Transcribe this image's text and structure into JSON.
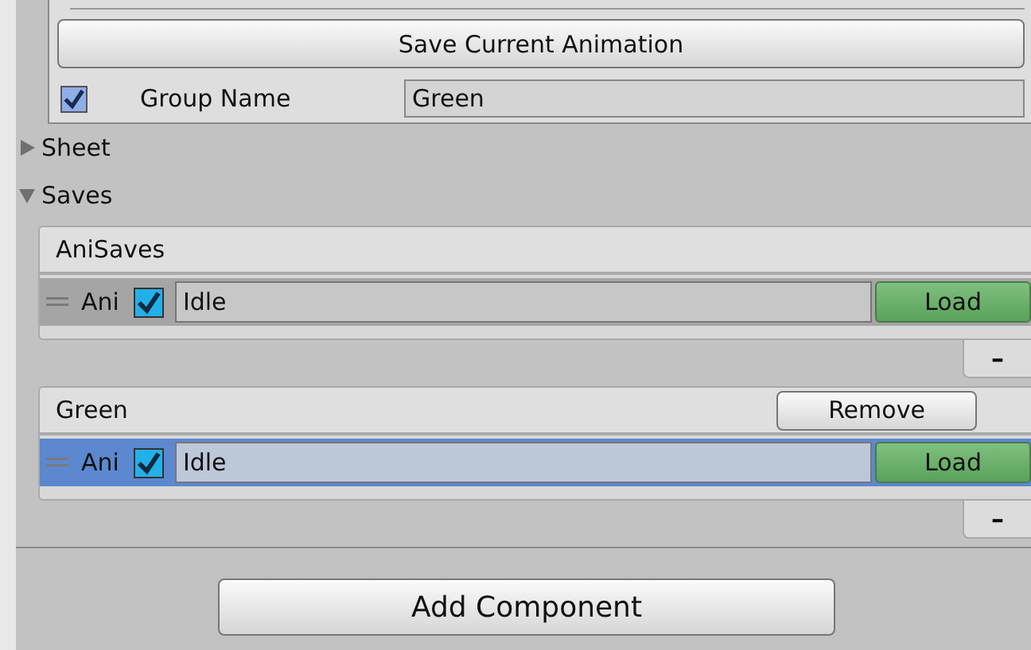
{
  "save_button": "Save Current Animation",
  "group_name": {
    "checked": true,
    "label": "Group Name",
    "value": "Green"
  },
  "foldouts": [
    {
      "label": "Sheet",
      "expanded": false
    },
    {
      "label": "Saves",
      "expanded": true
    }
  ],
  "lists": [
    {
      "header": "AniSaves",
      "footer_button": "–",
      "items": [
        {
          "label": "Ani",
          "checked": true,
          "value": "Idle",
          "button": "Load",
          "selected": false
        }
      ]
    },
    {
      "header": "Green",
      "remove_button": "Remove",
      "footer_button": "–",
      "items": [
        {
          "label": "Ani",
          "checked": true,
          "value": "Idle",
          "button": "Load",
          "selected": true
        }
      ]
    }
  ],
  "add_component": "Add Component"
}
